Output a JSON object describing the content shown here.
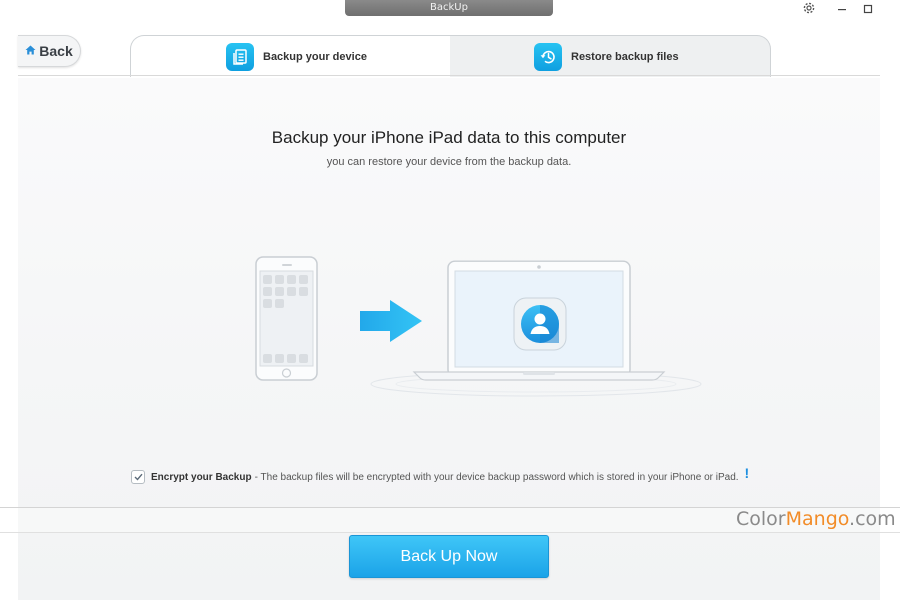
{
  "window": {
    "title": "BackUp",
    "settings_icon": "gear-icon",
    "minimize_icon": "minimize-icon",
    "maximize_icon": "maximize-icon"
  },
  "nav": {
    "back_label": "Back",
    "back_icon": "home-icon"
  },
  "tabs": [
    {
      "label": "Backup your device",
      "icon": "document-list-icon",
      "active": true
    },
    {
      "label": "Restore backup files",
      "icon": "restore-clock-icon",
      "active": false
    }
  ],
  "main": {
    "headline": "Backup your iPhone iPad data to this computer",
    "subline": "you can restore your device from the backup data.",
    "illustration": {
      "source_icon": "phone-icon",
      "arrow_icon": "right-arrow-icon",
      "target_icon": "laptop-icon",
      "app_icon": "app-logo-icon"
    }
  },
  "encrypt": {
    "checked": true,
    "title": "Encrypt your Backup",
    "description": "- The backup files will be encrypted with your device backup password which is stored in your iPhone or iPad.",
    "info_mark": "!"
  },
  "watermark": {
    "part1": "Color",
    "part2": "Mango",
    "part3": ".com"
  },
  "actions": {
    "backup_now_label": "Back Up Now"
  },
  "colors": {
    "accent": "#1ba3e8",
    "accent_light": "#3fc6f7",
    "watermark_orange": "#f28c28"
  }
}
